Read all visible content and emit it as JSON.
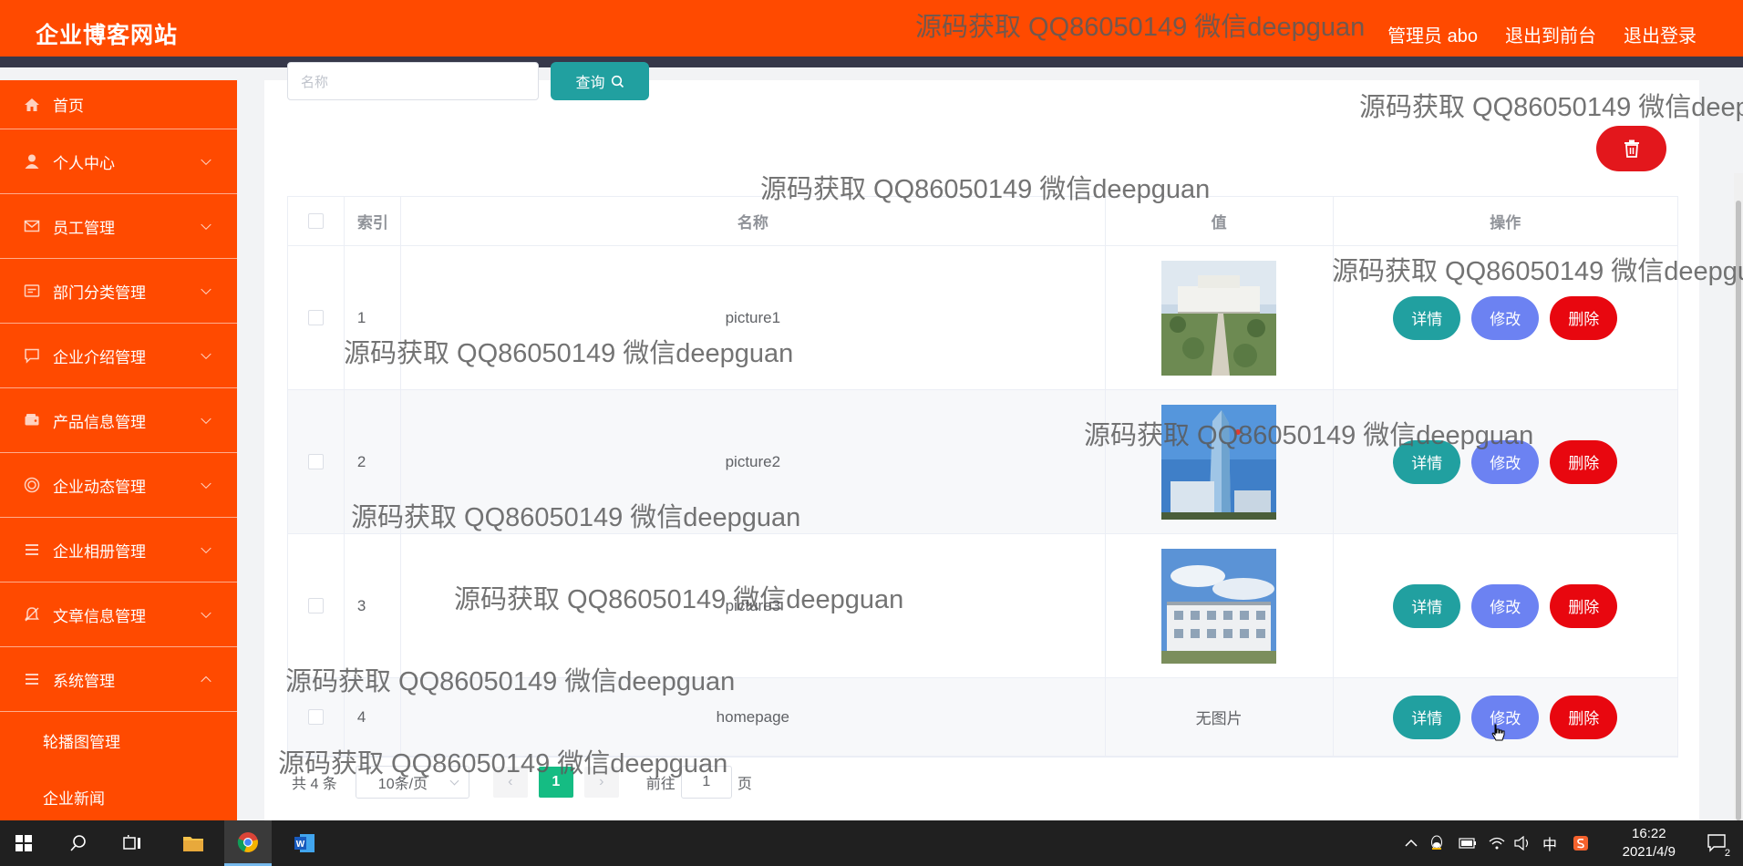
{
  "header": {
    "brand": "企业博客网站",
    "links": [
      {
        "label": "管理员 abo"
      },
      {
        "label": "退出到前台"
      },
      {
        "label": "退出登录"
      }
    ]
  },
  "sidebar": {
    "items": [
      {
        "label": "首页",
        "icon": "home-icon"
      },
      {
        "label": "个人中心",
        "icon": "user-icon"
      },
      {
        "label": "员工管理",
        "icon": "mail-icon"
      },
      {
        "label": "部门分类管理",
        "icon": "message-icon"
      },
      {
        "label": "企业介绍管理",
        "icon": "chat-icon"
      },
      {
        "label": "产品信息管理",
        "icon": "wallet-icon"
      },
      {
        "label": "企业动态管理",
        "icon": "target-icon"
      },
      {
        "label": "企业相册管理",
        "icon": "list-icon"
      },
      {
        "label": "文章信息管理",
        "icon": "bell-off-icon"
      },
      {
        "label": "系统管理",
        "icon": "list-icon"
      }
    ],
    "sub_items": [
      {
        "label": "轮播图管理"
      },
      {
        "label": "企业新闻"
      }
    ]
  },
  "search": {
    "placeholder": "名称",
    "button_label": "查询"
  },
  "table": {
    "headers": [
      "索引",
      "名称",
      "值",
      "操作"
    ],
    "rows": [
      {
        "index": "1",
        "name": "picture1",
        "value": "",
        "image": "building-photo-1"
      },
      {
        "index": "2",
        "name": "picture2",
        "value": "",
        "image": "building-photo-2"
      },
      {
        "index": "3",
        "name": "picture3",
        "value": "",
        "image": "building-photo-3"
      },
      {
        "index": "4",
        "name": "homepage",
        "value": "无图片",
        "image": ""
      }
    ],
    "actions": {
      "detail": "详情",
      "edit": "修改",
      "delete": "删除"
    }
  },
  "pagination": {
    "total": "共 4 条",
    "page_size": "10条/页",
    "current_page": "1",
    "goto_prefix": "前往",
    "goto_value": "1",
    "goto_suffix": "页"
  },
  "watermark": "源码获取 QQ86050149 微信deepguan",
  "taskbar": {
    "time": "16:22",
    "date": "2021/4/9",
    "ime": "中",
    "notification_count": "2"
  }
}
